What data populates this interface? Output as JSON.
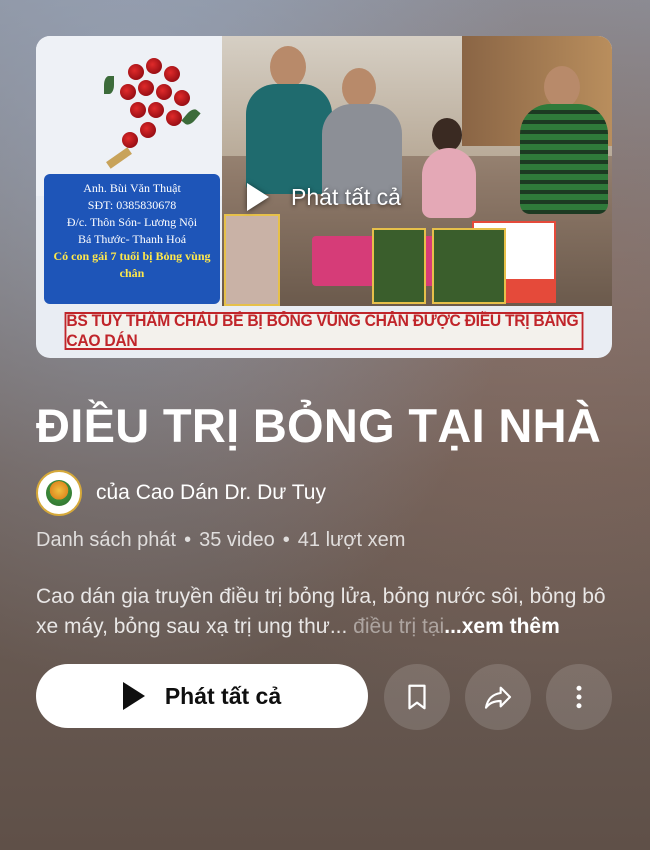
{
  "thumbnail": {
    "play_overlay_label": "Phát tất cả",
    "info_card": {
      "line1": "Anh. Bùi Văn Thuật",
      "line2": "SĐT: 0385830678",
      "line3": "Đ/c. Thôn Són- Lương Nội",
      "line4": "Bá Thước- Thanh Hoá",
      "line5": "Có con gái 7 tuổi bị Bỏng vùng chân"
    },
    "banner_text": "BS TUY THĂM CHÁU BÉ BỊ BỎNG VÙNG CHÂN ĐƯỢC ĐIỀU TRỊ BẰNG CAO DÁN"
  },
  "playlist": {
    "title": "ĐIỀU TRỊ BỎNG TẠI NHÀ",
    "channel": "của Cao Dán Dr. Dư Tuy",
    "type_label": "Danh sách phát",
    "video_count": "35 video",
    "views": "41 lượt xem",
    "separator": "•",
    "description": "Cao dán gia truyền điều trị bỏng lửa, bỏng nước sôi, bỏng bô xe máy, bỏng sau xạ trị ung thư...",
    "description_faded": " điều trị tại",
    "more_label": "...xem thêm"
  },
  "actions": {
    "play_all_label": "Phát tất cả",
    "save_icon": "bookmark-icon",
    "share_icon": "share-icon",
    "more_icon": "more-vertical-icon"
  },
  "colors": {
    "banner_red": "#c0252a",
    "card_blue": "#1e55b8",
    "card_highlight": "#ffe94a"
  }
}
